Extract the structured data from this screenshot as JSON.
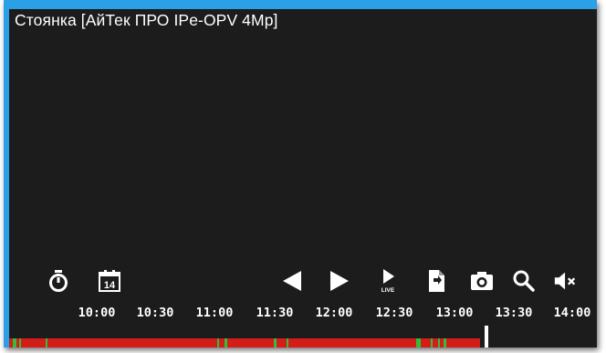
{
  "camera": {
    "title": "Стоянка [АйТек ПРО IPe-OPV 4Mp]"
  },
  "controls": [
    {
      "name": "timer-icon"
    },
    {
      "name": "calendar-icon",
      "day": "14"
    },
    {
      "name": "step-back-icon"
    },
    {
      "name": "play-icon"
    },
    {
      "name": "live-icon",
      "label": "LIVE"
    },
    {
      "name": "export-file-icon"
    },
    {
      "name": "snapshot-camera-icon"
    },
    {
      "name": "zoom-search-icon"
    },
    {
      "name": "mute-speaker-icon"
    }
  ],
  "timeline": {
    "ticks": [
      "10:00",
      "10:30",
      "11:00",
      "11:30",
      "12:00",
      "12:30",
      "13:00",
      "13:30",
      "14:00"
    ]
  },
  "colors": {
    "frame": "#2ca0e6",
    "viewport": "#1c1c1d",
    "recording_motion": "#d41d18",
    "recording_event": "#2fbf3a",
    "icons": "#ffffff"
  }
}
